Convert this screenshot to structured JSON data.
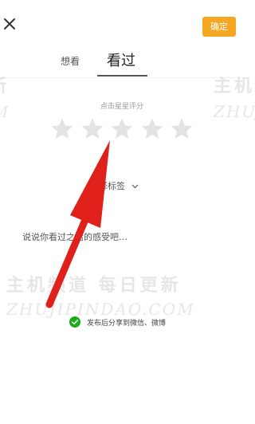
{
  "header": {
    "close_icon": "close-icon",
    "confirm_label": "确定"
  },
  "tabs": {
    "wanted_label": "想看",
    "seen_label": "看过",
    "active": "看过"
  },
  "rating": {
    "hint": "点击星星评分",
    "star_icon": "star-icon",
    "stars_total": 5,
    "stars_selected": 0
  },
  "tags": {
    "label": "选择标签",
    "chevron_icon": "chevron-down-icon"
  },
  "comment": {
    "placeholder": "说说你看过之后的感受吧…",
    "value": ""
  },
  "share": {
    "checked": true,
    "label": "发布后分享到微信、微博",
    "check_icon": "check-circle-icon"
  },
  "watermark": {
    "main_cn": "主机频道 每日更新",
    "main_en": "ZHUJIPINDAO.COM",
    "right_cn": "主机",
    "right_en": "ZHUJ",
    "left_cn": "新",
    "left_en": "M"
  },
  "colors": {
    "confirm_bg": "#f5a623",
    "star_empty": "#e3e3e3",
    "share_check": "#1aad19",
    "arrow": "#e0201b"
  }
}
